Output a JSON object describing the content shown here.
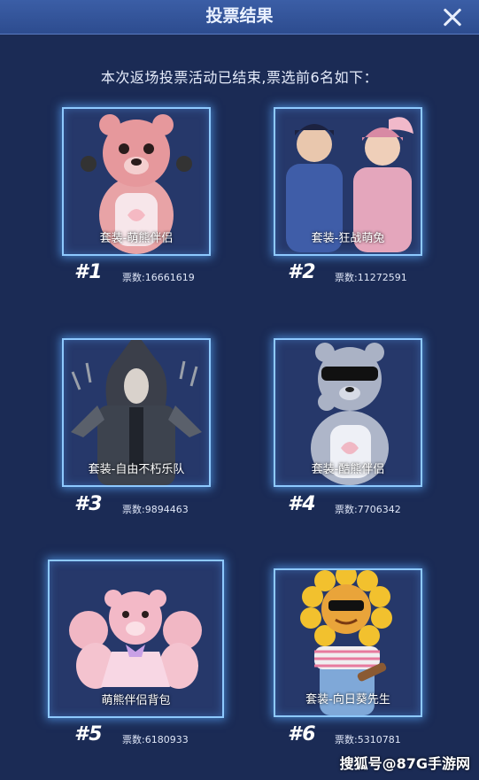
{
  "header": {
    "title": "投票结果",
    "close_icon": "close-icon"
  },
  "subtitle": "本次返场投票活动已结束,票选前6名如下：",
  "items": [
    {
      "rank": "#1",
      "name": "套装-萌熊伴侣",
      "votes": "票数:16661619"
    },
    {
      "rank": "#2",
      "name": "套装-狂战萌兔",
      "votes": "票数:11272591"
    },
    {
      "rank": "#3",
      "name": "套装-自由不朽乐队",
      "votes": "票数:9894463"
    },
    {
      "rank": "#4",
      "name": "套装-酷熊伴侣",
      "votes": "票数:7706342"
    },
    {
      "rank": "#5",
      "name": "萌熊伴侣背包",
      "votes": "票数:6180933"
    },
    {
      "rank": "#6",
      "name": "套装-向日葵先生",
      "votes": "票数:5310781"
    }
  ],
  "watermark": "搜狐号@87G手游网",
  "colors": {
    "background": "#1b2b55",
    "card_border": "#8ec9ff",
    "header": "#3b5ea6"
  }
}
